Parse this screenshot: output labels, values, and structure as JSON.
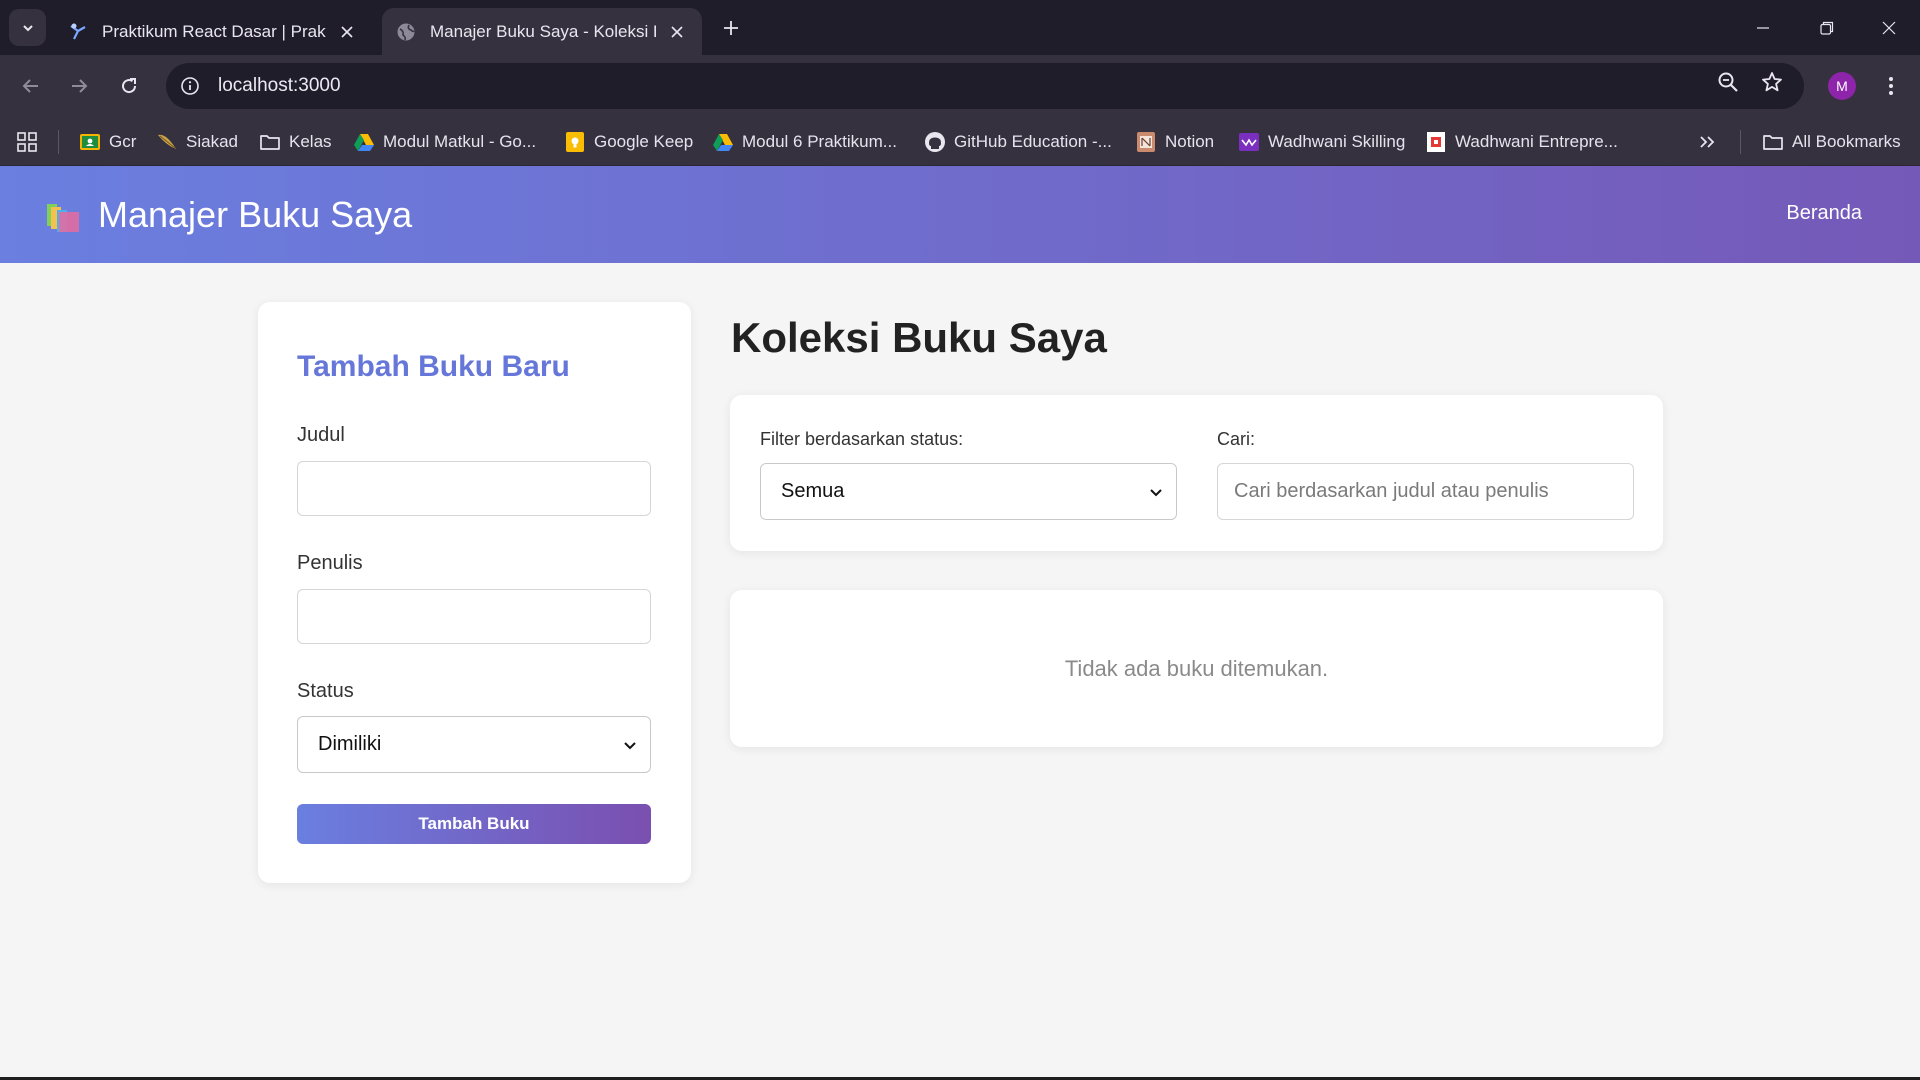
{
  "browser": {
    "tabs": [
      {
        "title": "Praktikum React Dasar | Praktik",
        "active": false
      },
      {
        "title": "Manajer Buku Saya - Koleksi Bu",
        "active": true
      }
    ],
    "url": "localhost:3000",
    "profile_initial": "M",
    "bookmarks": [
      {
        "label": "Gcr",
        "icon": "classroom-icon"
      },
      {
        "label": "Siakad",
        "icon": "feather-icon"
      },
      {
        "label": "Kelas",
        "icon": "folder-icon"
      },
      {
        "label": "Modul Matkul - Go...",
        "icon": "drive-icon"
      },
      {
        "label": "Google Keep",
        "icon": "keep-icon"
      },
      {
        "label": "Modul 6 Praktikum...",
        "icon": "drive-icon"
      },
      {
        "label": "GitHub Education -...",
        "icon": "github-icon"
      },
      {
        "label": "Notion",
        "icon": "notion-icon"
      },
      {
        "label": "Wadhwani Skilling",
        "icon": "wadhwani-icon"
      },
      {
        "label": "Wadhwani Entrepre...",
        "icon": "wadhwani-entre-icon"
      }
    ],
    "all_bookmarks_label": "All Bookmarks"
  },
  "header": {
    "title": "Manajer Buku Saya",
    "nav_home": "Beranda"
  },
  "form": {
    "title": "Tambah Buku Baru",
    "title_label": "Judul",
    "title_value": "",
    "author_label": "Penulis",
    "author_value": "",
    "status_label": "Status",
    "status_value": "Dimiliki",
    "submit_label": "Tambah Buku"
  },
  "collection": {
    "title": "Koleksi Buku Saya",
    "filter_label": "Filter berdasarkan status:",
    "filter_value": "Semua",
    "search_label": "Cari:",
    "search_placeholder": "Cari berdasarkan judul atau penulis",
    "empty_message": "Tidak ada buku ditemukan."
  },
  "colors": {
    "header_gradient_start": "#6a7fe0",
    "header_gradient_end": "#7559b8",
    "form_title": "#6677d9"
  }
}
